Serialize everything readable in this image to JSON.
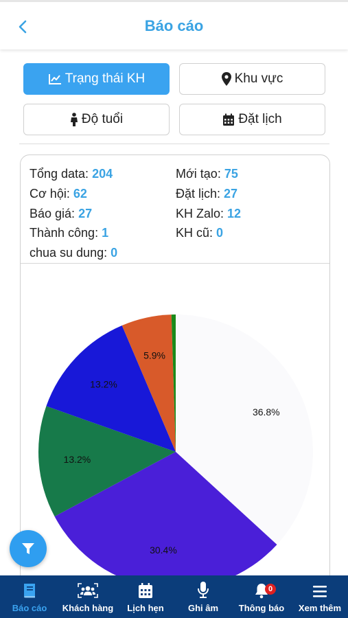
{
  "header": {
    "title": "Báo cáo"
  },
  "tabs": [
    {
      "label": "Trạng thái KH",
      "icon": "line-chart-icon",
      "active": true
    },
    {
      "label": "Khu vực",
      "icon": "map-pin-icon",
      "active": false
    },
    {
      "label": "Độ tuổi",
      "icon": "person-icon",
      "active": false
    },
    {
      "label": "Đặt lịch",
      "icon": "calendar-icon",
      "active": false
    }
  ],
  "stats": [
    {
      "label": "Tổng data:",
      "value": "204"
    },
    {
      "label": "Mới tạo:",
      "value": "75"
    },
    {
      "label": "Cơ hội:",
      "value": "62"
    },
    {
      "label": "Đặt lịch:",
      "value": "27"
    },
    {
      "label": "Báo giá:",
      "value": "27"
    },
    {
      "label": "KH Zalo:",
      "value": "12"
    },
    {
      "label": "Thành công:",
      "value": "1"
    },
    {
      "label": "KH cũ:",
      "value": "0"
    },
    {
      "label": "chua su dung:",
      "value": "0"
    }
  ],
  "chart_data": {
    "type": "pie",
    "start_angle_deg": -90,
    "slices": [
      {
        "value": 36.8,
        "label": "36.8%",
        "color": "#fafafc"
      },
      {
        "value": 30.4,
        "label": "30.4%",
        "color": "#4a1fd8"
      },
      {
        "value": 13.2,
        "label": "13.2%",
        "color": "#177a4a"
      },
      {
        "value": 13.2,
        "label": "13.2%",
        "color": "#1818d8"
      },
      {
        "value": 5.9,
        "label": "5.9%",
        "color": "#d85a2a"
      },
      {
        "value": 0.5,
        "label": "",
        "color": "#1a8a1a"
      }
    ]
  },
  "colors": {
    "accent": "#3aa3f0",
    "nav_bg": "#0b3d7a",
    "badge": "#e02020"
  },
  "nav": [
    {
      "label": "Báo cáo",
      "icon": "book-icon",
      "active": true
    },
    {
      "label": "Khách hàng",
      "icon": "users-icon",
      "active": false
    },
    {
      "label": "Lịch hẹn",
      "icon": "calendar-icon",
      "active": false
    },
    {
      "label": "Ghi âm",
      "icon": "microphone-icon",
      "active": false
    },
    {
      "label": "Thông báo",
      "icon": "bell-icon",
      "active": false,
      "badge": "0"
    },
    {
      "label": "Xem thêm",
      "icon": "menu-icon",
      "active": false
    }
  ]
}
